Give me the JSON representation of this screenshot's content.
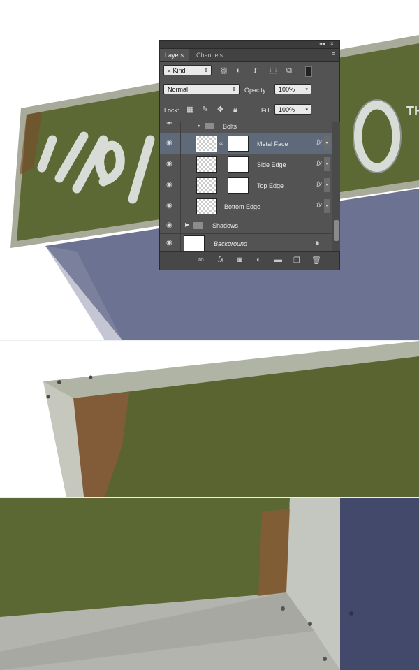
{
  "panel": {
    "collapse_glyph": "◂◂",
    "close_glyph": "×",
    "tabs": [
      {
        "label": "Layers"
      },
      {
        "label": "Channels"
      }
    ],
    "menu_glyph": "≡",
    "filter": {
      "label": "Kind"
    },
    "blend_mode": "Normal",
    "opacity_label": "Opacity:",
    "opacity_value": "100%",
    "lock_label": "Lock:",
    "fill_label": "Fill:",
    "fill_value": "100%",
    "layers": [
      {
        "name": "Bolts",
        "type": "group"
      },
      {
        "name": "Metal Face",
        "selected": true,
        "fx": "fx"
      },
      {
        "name": "Side Edge",
        "fx": "fx"
      },
      {
        "name": "Top Edge",
        "fx": "fx"
      },
      {
        "name": "Bottom Edge",
        "fx": "fx"
      },
      {
        "name": "Shadows",
        "type": "group"
      },
      {
        "name": "Background",
        "locked": true
      }
    ],
    "icons": {
      "filter": "search-icon",
      "link": "link-icon",
      "add_style": "fx-icon",
      "mask": "mask-icon",
      "adjustment": "adjustment-icon",
      "group": "folder-icon",
      "new_layer": "new-layer-icon",
      "delete": "trash-icon"
    }
  },
  "colors": {
    "sign_green": "#5e6a36",
    "frame_grey": "#b7b9a8",
    "shadow_blue": "#6a7190",
    "panel_bg": "#535353",
    "selected_row": "#5e6a7a"
  }
}
